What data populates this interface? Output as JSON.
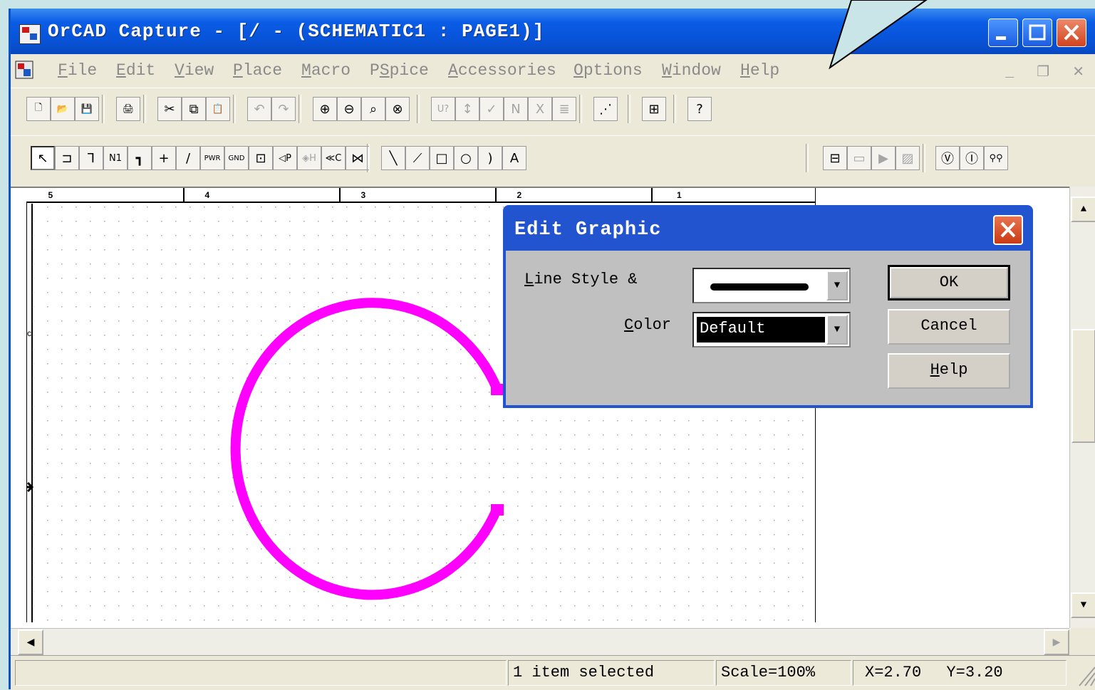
{
  "window": {
    "title": "OrCAD Capture - [/ - (SCHEMATIC1 : PAGE1)]"
  },
  "menubar": [
    {
      "label": "File",
      "key": "F",
      "rest": "ile"
    },
    {
      "label": "Edit",
      "key": "E",
      "rest": "dit"
    },
    {
      "label": "View",
      "key": "V",
      "rest": "iew"
    },
    {
      "label": "Place",
      "key": "P",
      "rest": "lace"
    },
    {
      "label": "Macro",
      "key": "M",
      "rest": "acro"
    },
    {
      "label": "PSpice",
      "key": "S",
      "pre": "P",
      "rest": "pice"
    },
    {
      "label": "Accessories",
      "key": "A",
      "rest": "ccessories"
    },
    {
      "label": "Options",
      "key": "O",
      "rest": "ptions"
    },
    {
      "label": "Window",
      "key": "W",
      "rest": "indow"
    },
    {
      "label": "Help",
      "key": "H",
      "rest": "elp"
    }
  ],
  "toolbar1": [
    {
      "name": "new-icon",
      "glyph": "🗋"
    },
    {
      "name": "open-icon",
      "glyph": "📂"
    },
    {
      "name": "save-icon",
      "glyph": "💾"
    },
    {
      "name": "print-icon",
      "glyph": "🖨"
    },
    {
      "name": "cut-icon",
      "glyph": "✂"
    },
    {
      "name": "copy-icon",
      "glyph": "⧉"
    },
    {
      "name": "paste-icon",
      "glyph": "📋"
    },
    {
      "name": "undo-icon",
      "glyph": "↶"
    },
    {
      "name": "redo-icon",
      "glyph": "↷"
    },
    {
      "name": "zoom-in-icon",
      "glyph": "⊕"
    },
    {
      "name": "zoom-out-icon",
      "glyph": "⊖"
    },
    {
      "name": "zoom-area-icon",
      "glyph": "⌕"
    },
    {
      "name": "zoom-all-icon",
      "glyph": "⊗"
    },
    {
      "name": "annotate-icon",
      "glyph": "U?"
    },
    {
      "name": "back-annotate-icon",
      "glyph": "↕"
    },
    {
      "name": "drc-icon",
      "glyph": "✓"
    },
    {
      "name": "netlist-icon",
      "glyph": "N"
    },
    {
      "name": "cross-reference-icon",
      "glyph": "X"
    },
    {
      "name": "bom-icon",
      "glyph": "≣"
    },
    {
      "name": "snap-grid-icon",
      "glyph": "⋰"
    },
    {
      "name": "project-manager-icon",
      "glyph": "⊞"
    },
    {
      "name": "help-icon",
      "glyph": "?"
    }
  ],
  "toolbar2": [
    {
      "name": "select-icon",
      "glyph": "↖"
    },
    {
      "name": "place-part-icon",
      "glyph": "⊐"
    },
    {
      "name": "place-wire-icon",
      "glyph": "⅂"
    },
    {
      "name": "place-net-alias-icon",
      "glyph": "N1"
    },
    {
      "name": "place-bus-icon",
      "glyph": "┓"
    },
    {
      "name": "place-junction-icon",
      "glyph": "+"
    },
    {
      "name": "place-bus-entry-icon",
      "glyph": "/"
    },
    {
      "name": "place-power-icon",
      "glyph": "PWR"
    },
    {
      "name": "place-ground-icon",
      "glyph": "GND"
    },
    {
      "name": "place-hierarchical-block-icon",
      "glyph": "⊡"
    },
    {
      "name": "place-port-icon",
      "glyph": "◁P"
    },
    {
      "name": "place-pin-icon",
      "glyph": "◈H"
    },
    {
      "name": "place-off-page-connector-icon",
      "glyph": "≪C"
    },
    {
      "name": "place-no-connect-icon",
      "glyph": "⋈"
    },
    {
      "name": "place-line-icon",
      "glyph": "╲"
    },
    {
      "name": "place-polyline-icon",
      "glyph": "⟋"
    },
    {
      "name": "place-rectangle-icon",
      "glyph": "□"
    },
    {
      "name": "place-ellipse-icon",
      "glyph": "○"
    },
    {
      "name": "place-arc-icon",
      "glyph": ")"
    },
    {
      "name": "place-text-icon",
      "glyph": "A"
    },
    {
      "name": "new-simulation-profile-icon",
      "glyph": "⊟"
    },
    {
      "name": "edit-simulation-profile-icon",
      "glyph": "▭"
    },
    {
      "name": "run-pspice-icon",
      "glyph": "▶"
    },
    {
      "name": "view-simulation-results-icon",
      "glyph": "▨"
    },
    {
      "name": "voltage-marker-icon",
      "glyph": "Ⓥ"
    },
    {
      "name": "current-marker-icon",
      "glyph": "Ⓘ"
    },
    {
      "name": "differential-marker-icon",
      "glyph": "⚲⚲"
    }
  ],
  "ruler": {
    "labels": [
      "5",
      "4",
      "3",
      "2",
      "1"
    ],
    "row_label": "C"
  },
  "dialog": {
    "title": "Edit Graphic",
    "line_style_label": {
      "key": "L",
      "rest": "ine Style &"
    },
    "color_label": {
      "key": "C",
      "rest": "olor"
    },
    "color_value": "Default",
    "ok": "OK",
    "cancel": "Cancel",
    "help": {
      "key": "H",
      "rest": "elp"
    }
  },
  "statusbar": {
    "message": "1 item selected",
    "scale": "Scale=100%",
    "x": "X=2.70",
    "y": "Y=3.20"
  },
  "colors": {
    "arc": "#ff00ff",
    "title_bar": "#0a5ce6",
    "dialog_frame": "#2254d0",
    "background": "#c9e5e8"
  }
}
